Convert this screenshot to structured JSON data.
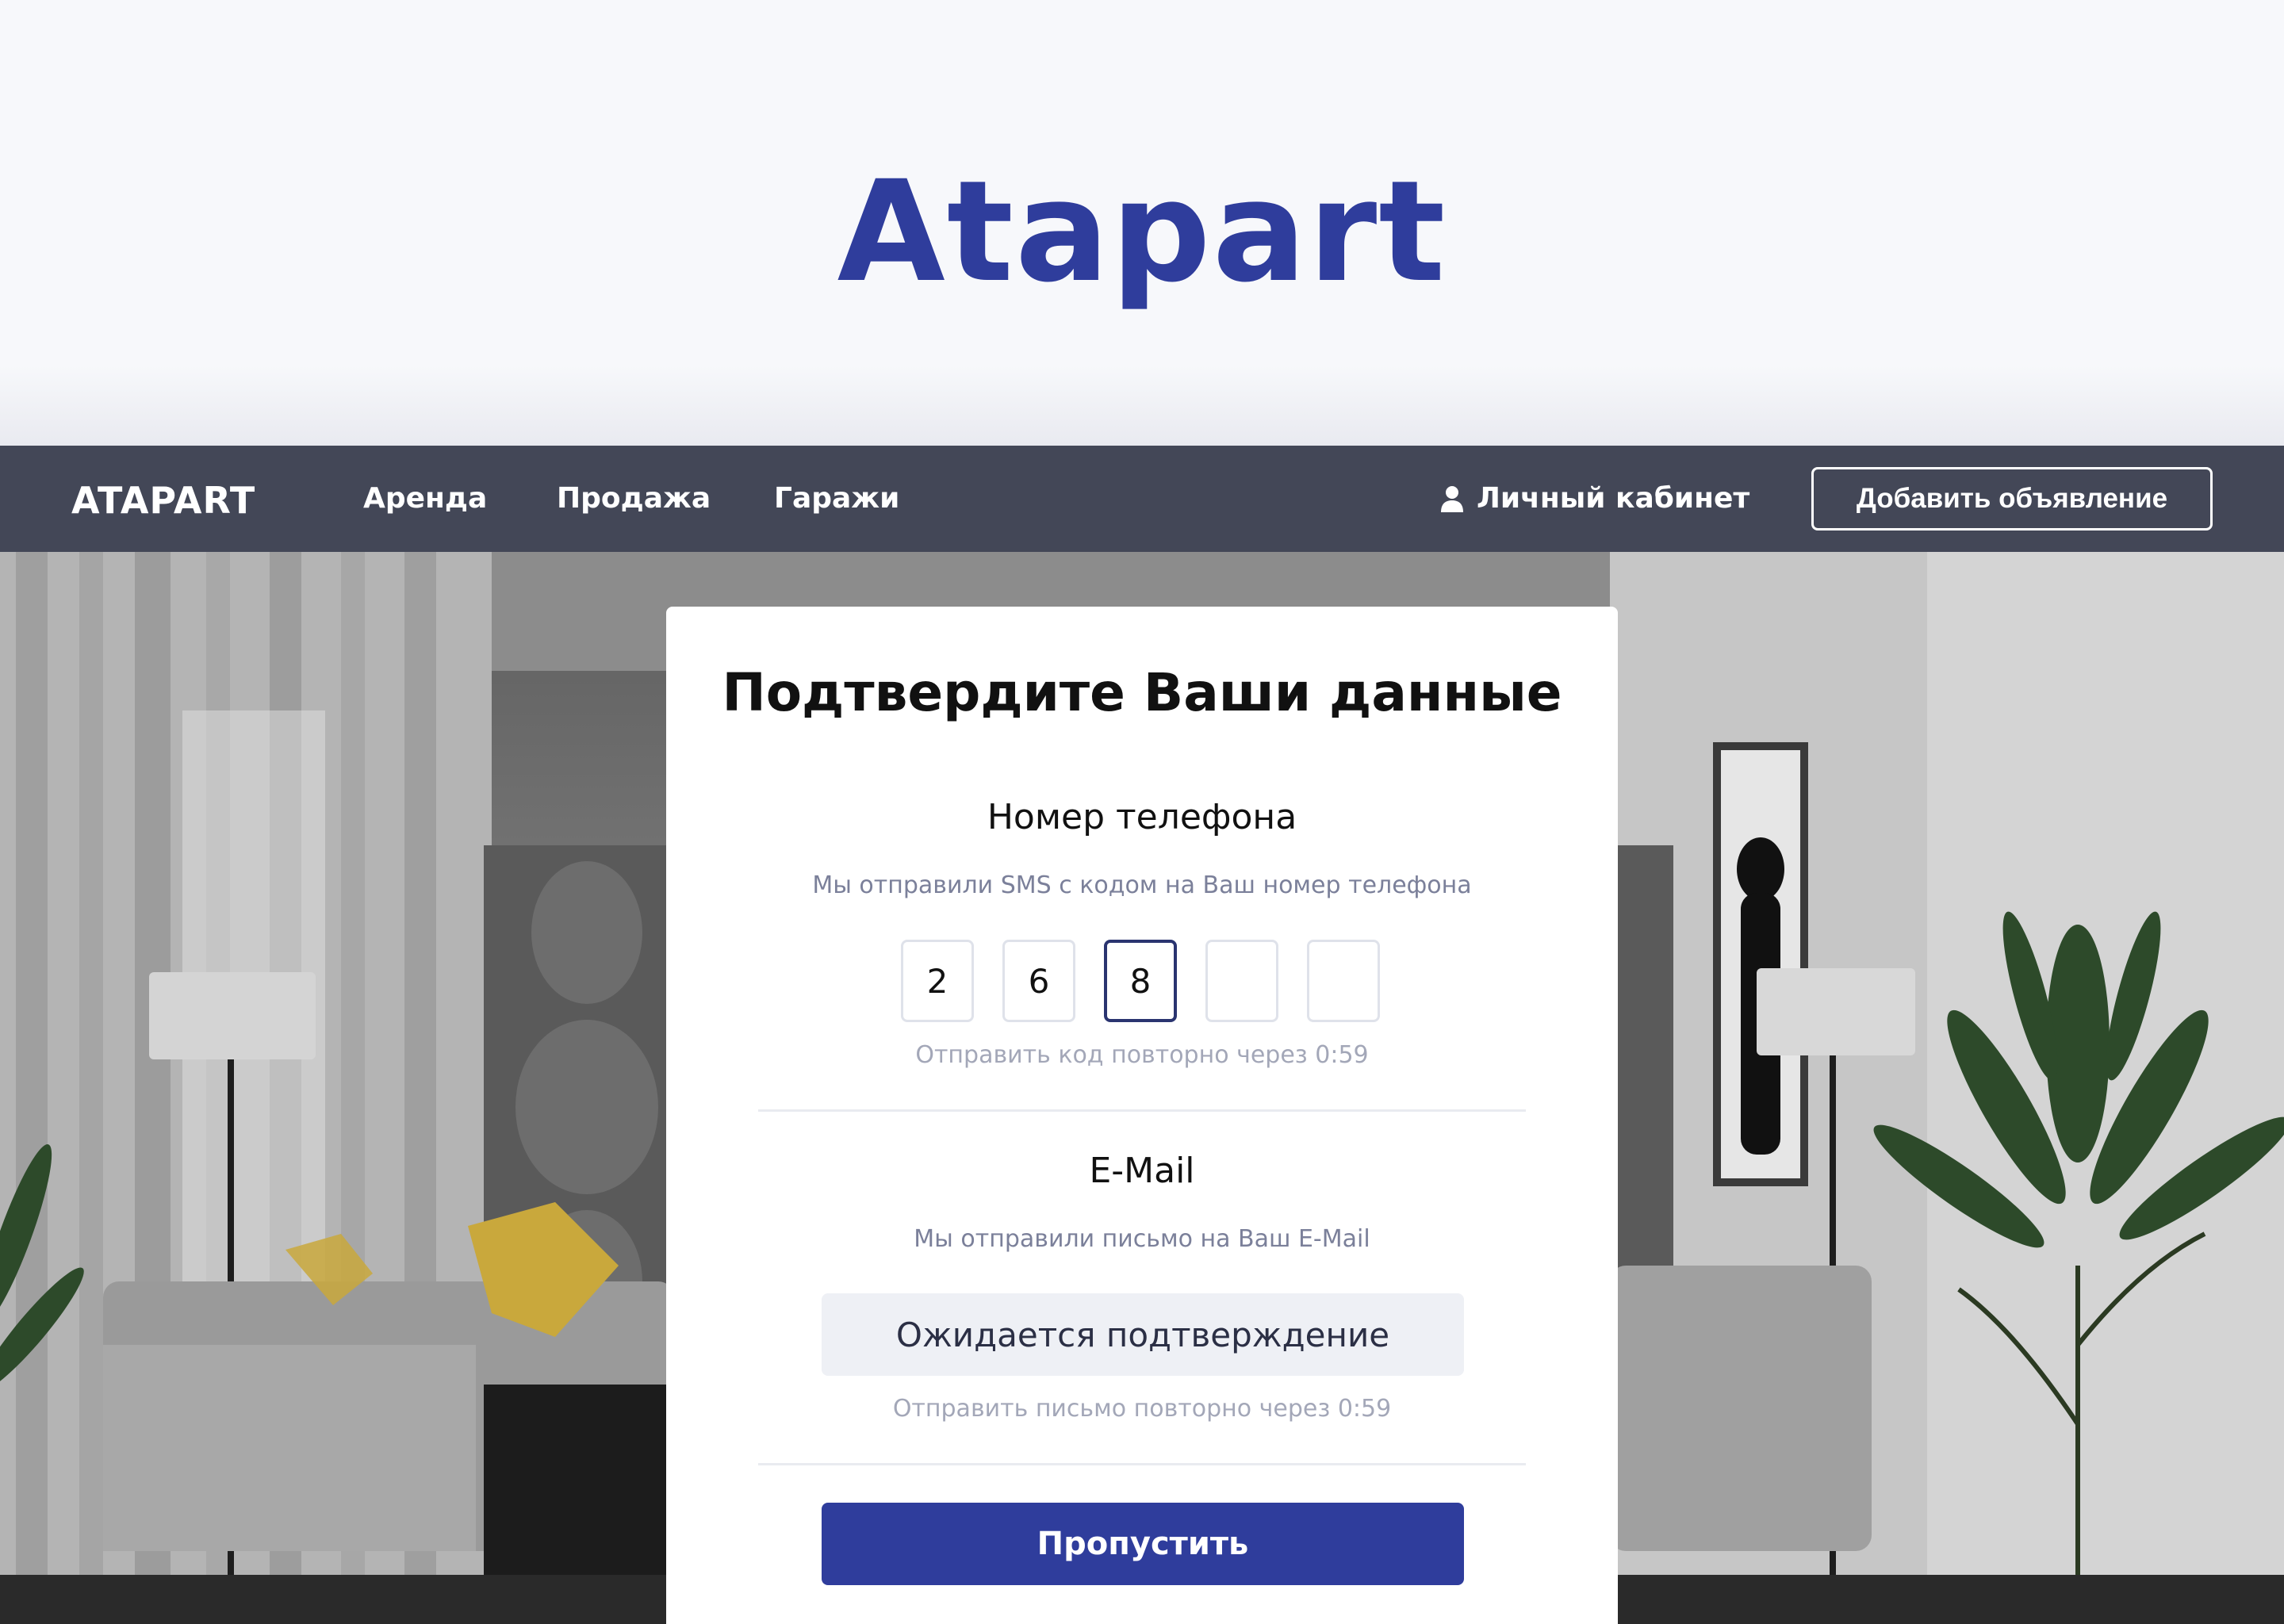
{
  "brand": {
    "title": "Atapart",
    "color": "#2f3d9c"
  },
  "nav": {
    "logo": "ATAPART",
    "links": [
      "Аренда",
      "Продажа",
      "Гаражи"
    ],
    "cabinet": "Личный кабинет",
    "cabinet_icon": "user-icon",
    "add_button": "Добавить объявление",
    "background": "#434757"
  },
  "card": {
    "title": "Подтвердите Ваши данные",
    "phone": {
      "title": "Номер телефона",
      "hint": "Мы отправили SMS с кодом на Ваш номер телефона",
      "code": [
        "2",
        "6",
        "8",
        "",
        ""
      ],
      "active_index": 2,
      "resend": "Отправить код повторно через 0:59"
    },
    "email": {
      "title": "E-Mail",
      "hint": "Мы отправили письмо на Ваш E-Mail",
      "status": "Ожидается подтверждение",
      "resend": "Отправить письмо повторно через 0:59"
    },
    "skip_button": "Пропустить",
    "accent": "#2f3d9c"
  }
}
